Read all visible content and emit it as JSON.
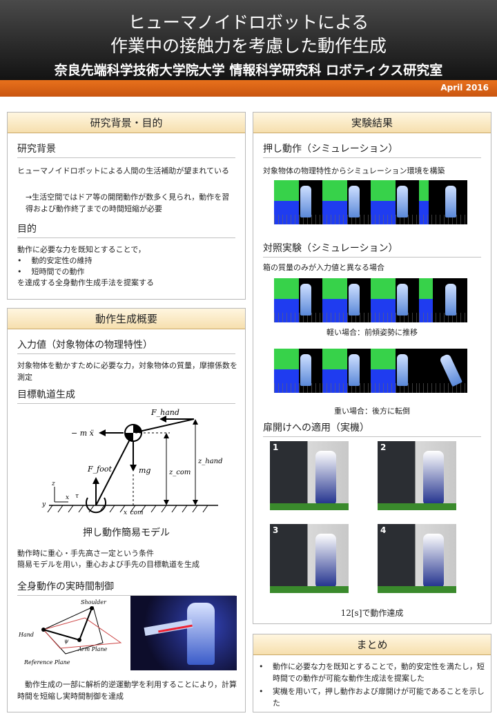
{
  "header": {
    "title_line1": "ヒューマノイドロボットによる",
    "title_line2": "作業中の接触力を考慮した動作生成",
    "affiliation": "奈良先端科学技術大学院大学 情報科学研究科 ロボティクス研究室",
    "date": "April 2016"
  },
  "background": {
    "title": "研究背景・目的",
    "sub1": "研究背景",
    "text1": "ヒューマノイドロボットによる人間の生活補助が望まれている",
    "text2": "→生活空間ではドア等の開閉動作が数多く見られ，動作を習得および動作終了までの時間短縮が必要",
    "sub2": "目的",
    "purpose_line1": "動作に必要な力を既知とすることで，",
    "purpose_b1": "動的安定性の維持",
    "purpose_b2": "短時間での動作",
    "purpose_line2": "を達成する全身動作生成手法を提案する"
  },
  "overview": {
    "title": "動作生成概要",
    "sub1": "入力値（対象物体の物理特性）",
    "text1": "対象物体を動かすために必要な力，対象物体の質量，摩擦係数を測定",
    "sub2": "目標軌道生成",
    "diagram": {
      "f_hand": "F_hand",
      "m_x": "− m ẍ",
      "mg": "mg",
      "z_com": "z_com",
      "z_hand": "z_hand",
      "f_foot": "F_foot",
      "z": "z",
      "x": "x",
      "y": "y",
      "tau": "τ",
      "x_com": "x_com"
    },
    "model_caption": "押し動作簡易モデル",
    "text2": "動作時に重心・手先高さ一定という条件",
    "text3": "簡易モデルを用い，重心および手先の目標軌道を生成",
    "sub3": "全身動作の実時間制御",
    "arm": {
      "shoulder": "Shoulder",
      "hand": "Hand",
      "arm_plane": "Arm Plane",
      "ref_plane": "Reference Plane",
      "psi": "ψ"
    },
    "text4": "動作生成の一部に解析的逆運動学を利用することにより，計算時間を短縮し実時間制御を達成"
  },
  "results": {
    "title": "実験結果",
    "sub1": "押し動作（シミュレーション）",
    "text1": "対象物体の物理特性からシミュレーション環境を構築",
    "sub2": "対照実験（シミュレーション）",
    "text2": "箱の質量のみが入力値と異なる場合",
    "caption_light": "軽い場合：前傾姿勢に推移",
    "caption_heavy": "重い場合：後方に転倒",
    "sub3": "扉開けへの適用（実機）",
    "photo_nums": [
      "1",
      "2",
      "3",
      "4"
    ],
    "caption_door": "12[s]で動作達成"
  },
  "summary": {
    "title": "まとめ",
    "b1": "動作に必要な力を既知とすることで，動的安定性を満たし，短時間での動作が可能な動作生成法を提案した",
    "b2": "実機を用いて，押し動作および扉開けが可能であることを示した"
  },
  "colors": {
    "accent": "#e8711c",
    "title_bg": "#f6dfae",
    "sim_green": "#37d24a",
    "sim_blue": "#1f3cf0"
  }
}
